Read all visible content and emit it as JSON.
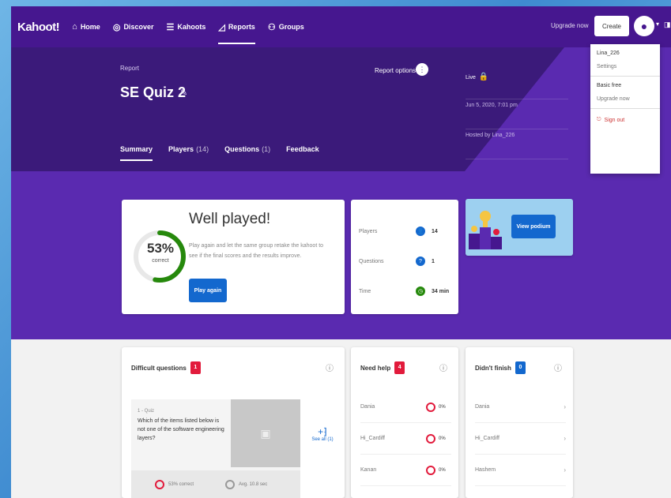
{
  "nav": {
    "logo": "Kahoot!",
    "items": [
      {
        "icon": "⌂",
        "label": "Home",
        "active": false
      },
      {
        "icon": "◎",
        "label": "Discover",
        "active": false
      },
      {
        "icon": "☰",
        "label": "Kahoots",
        "active": false
      },
      {
        "icon": "◿",
        "label": "Reports",
        "active": true
      },
      {
        "icon": "⚇",
        "label": "Groups",
        "active": false
      }
    ],
    "upgrade": "Upgrade now",
    "create": "Create"
  },
  "report": {
    "label": "Report",
    "title": "SE Quiz 2",
    "options": "Report options",
    "tabs": [
      {
        "label": "Summary",
        "count": ""
      },
      {
        "label": "Players",
        "count": "(14)"
      },
      {
        "label": "Questions",
        "count": "(1)"
      },
      {
        "label": "Feedback",
        "count": ""
      }
    ],
    "meta": [
      "Live",
      "Jun 5, 2020, 7:01 pm",
      "Hosted by Lina_226"
    ]
  },
  "dropdown": {
    "user": "Lina_226",
    "settings": "Settings",
    "plan": "Basic free",
    "upgrade": "Upgrade now",
    "signout": "Sign out"
  },
  "result": {
    "percent": "53%",
    "percent_sub": "correct",
    "percent_value": 0.53,
    "title": "Well played!",
    "body": "Play again and let the same group retake the kahoot to see if the final scores and the results improve.",
    "button": "Play again"
  },
  "stats": [
    {
      "label": "Players",
      "value": "14",
      "color": "#1368ce",
      "icon": "👤"
    },
    {
      "label": "Questions",
      "value": "1",
      "color": "#1368ce",
      "icon": "?"
    },
    {
      "label": "Time",
      "value": "34 min",
      "color": "#26890c",
      "icon": "◷"
    }
  ],
  "podium": {
    "button": "View podium"
  },
  "difficult": {
    "title": "Difficult questions",
    "count": "1",
    "q_num": "1 - Quiz",
    "q_text": "Which of the items listed below is not one of the software engineering layers?",
    "correct": "53% correct",
    "time": "Avg. 10.8 sec",
    "see_all": "See all (1)"
  },
  "help": {
    "title": "Need help",
    "count": "4",
    "rows": [
      {
        "name": "Dania",
        "pct": "0%"
      },
      {
        "name": "Hi_Cardiff",
        "pct": "0%"
      },
      {
        "name": "Kanan",
        "pct": "0%"
      }
    ]
  },
  "finish": {
    "title": "Didn't finish",
    "count": "0",
    "rows": [
      {
        "name": "Dania"
      },
      {
        "name": "Hi_Cardiff"
      },
      {
        "name": "Hashem"
      }
    ]
  }
}
